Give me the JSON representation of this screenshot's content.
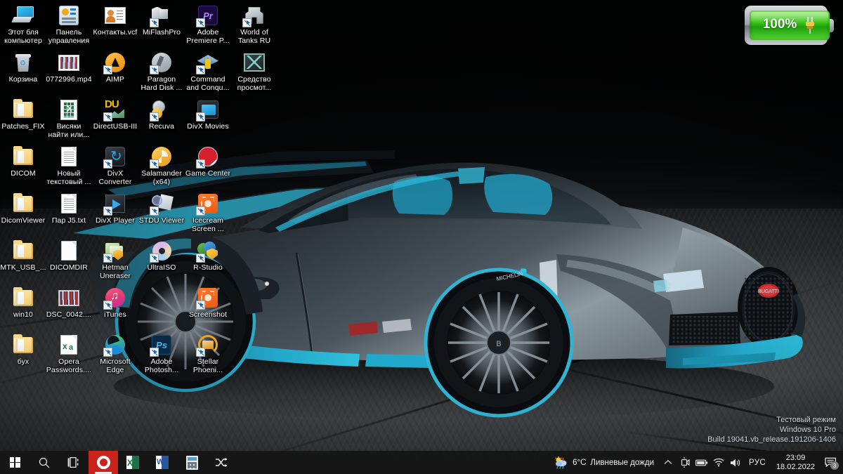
{
  "desktop": {
    "wallpaper_description": "Bugatti Divo supercar, dark grey with cyan accents, on dark asphalt",
    "colors": {
      "car_body_dark": "#2b3238",
      "car_accent_cyan": "#2aa6c8",
      "car_highlight": "#8f9ba3",
      "ground": "#3a3d40",
      "sky": "#07090a",
      "taskbar": "#161616",
      "opera_red": "#c9231c",
      "battery_green": "#35c215"
    },
    "icons": [
      {
        "label_line1": "Этот бля",
        "label_line2": "компьютер",
        "glyph": "this-pc-icon",
        "shortcut": false
      },
      {
        "label_line1": "Панель",
        "label_line2": "управления",
        "glyph": "control-panel-icon",
        "shortcut": false
      },
      {
        "label_line1": "Контакты.vcf",
        "label_line2": "",
        "glyph": "contacts-vcf-icon",
        "shortcut": false
      },
      {
        "label_line1": "MiFlashPro",
        "label_line2": "",
        "glyph": "miflashpro-icon",
        "shortcut": true
      },
      {
        "label_line1": "Adobe",
        "label_line2": "Premiere P...",
        "glyph": "adobe-premiere-icon",
        "shortcut": true
      },
      {
        "label_line1": "World of",
        "label_line2": "Tanks RU",
        "glyph": "world-of-tanks-icon",
        "shortcut": true
      },
      {
        "label_line1": "Корзина",
        "label_line2": "",
        "glyph": "recycle-bin-icon",
        "shortcut": false
      },
      {
        "label_line1": "0772996.mp4",
        "label_line2": "",
        "glyph": "video-thumbnail-icon",
        "shortcut": false
      },
      {
        "label_line1": "AIMP",
        "label_line2": "",
        "glyph": "aimp-icon",
        "shortcut": true
      },
      {
        "label_line1": "Paragon",
        "label_line2": "Hard Disk ...",
        "glyph": "paragon-hard-disk-icon",
        "shortcut": true
      },
      {
        "label_line1": "Command",
        "label_line2": "and Conqu...",
        "glyph": "command-and-conquer-icon",
        "shortcut": true
      },
      {
        "label_line1": "Средство",
        "label_line2": "просмот...",
        "glyph": "snipping-tool-icon",
        "shortcut": false
      },
      {
        "label_line1": "Patches_FIX",
        "label_line2": "",
        "glyph": "folder-icon",
        "shortcut": false
      },
      {
        "label_line1": "Висяки",
        "label_line2": "найти или...",
        "glyph": "excel-file-icon",
        "shortcut": false
      },
      {
        "label_line1": "DirectUSB-III",
        "label_line2": "",
        "glyph": "directusb-icon",
        "shortcut": true
      },
      {
        "label_line1": "Recuva",
        "label_line2": "",
        "glyph": "recuva-icon",
        "shortcut": true
      },
      {
        "label_line1": "DivX Movies",
        "label_line2": "",
        "glyph": "divx-movies-folder-icon",
        "shortcut": true
      },
      {
        "label_line1": "DICOM",
        "label_line2": "",
        "glyph": "folder-icon",
        "shortcut": false
      },
      {
        "label_line1": "Новый",
        "label_line2": "текстовый ...",
        "glyph": "text-document-icon",
        "shortcut": false
      },
      {
        "label_line1": "DivX",
        "label_line2": "Converter",
        "glyph": "divx-converter-icon",
        "shortcut": true
      },
      {
        "label_line1": "Salamander",
        "label_line2": "(x64)",
        "glyph": "salamander-icon",
        "shortcut": true
      },
      {
        "label_line1": "Game Center",
        "label_line2": "",
        "glyph": "game-center-icon",
        "shortcut": true
      },
      {
        "label_line1": "DicomViewer",
        "label_line2": "",
        "glyph": "folder-icon",
        "shortcut": false
      },
      {
        "label_line1": "Пар J5.txt",
        "label_line2": "",
        "glyph": "text-document-icon",
        "shortcut": false
      },
      {
        "label_line1": "DivX Player",
        "label_line2": "",
        "glyph": "divx-player-icon",
        "shortcut": true
      },
      {
        "label_line1": "STDU Viewer",
        "label_line2": "",
        "glyph": "stdu-viewer-icon",
        "shortcut": true
      },
      {
        "label_line1": "Icecream",
        "label_line2": "Screen ...",
        "glyph": "icecream-screen-recorder-icon",
        "shortcut": true
      },
      {
        "label_line1": "MTK_USB_...",
        "label_line2": "",
        "glyph": "folder-icon",
        "shortcut": false
      },
      {
        "label_line1": "DICOMDIR",
        "label_line2": "",
        "glyph": "blank-file-icon",
        "shortcut": false
      },
      {
        "label_line1": "Hetman",
        "label_line2": "Uneraser",
        "glyph": "hetman-uneraser-icon",
        "shortcut": true
      },
      {
        "label_line1": "UltraISO",
        "label_line2": "",
        "glyph": "ultraiso-icon",
        "shortcut": true
      },
      {
        "label_line1": "R-Studio",
        "label_line2": "",
        "glyph": "r-studio-icon",
        "shortcut": true
      },
      {
        "label_line1": "win10",
        "label_line2": "",
        "glyph": "folder-icon",
        "shortcut": false
      },
      {
        "label_line1": "DSC_0042....",
        "label_line2": "",
        "glyph": "photo-thumbnail-icon",
        "shortcut": false
      },
      {
        "label_line1": "iTunes",
        "label_line2": "",
        "glyph": "itunes-icon",
        "shortcut": true
      },
      {
        "label_line1": "Screenshot",
        "label_line2": "",
        "glyph": "screenshot-icon",
        "shortcut": true
      },
      {
        "label_line1": "бух",
        "label_line2": "",
        "glyph": "folder-icon",
        "shortcut": false
      },
      {
        "label_line1": "Opera",
        "label_line2": "Passwords....",
        "glyph": "opera-passwords-excel-icon",
        "shortcut": false
      },
      {
        "label_line1": "Microsoft",
        "label_line2": "Edge",
        "glyph": "microsoft-edge-icon",
        "shortcut": true
      },
      {
        "label_line1": "Adobe",
        "label_line2": "Photosh...",
        "glyph": "adobe-photoshop-icon",
        "shortcut": true
      },
      {
        "label_line1": "Stellar",
        "label_line2": "Phoeni...",
        "glyph": "stellar-phoenix-icon",
        "shortcut": true
      }
    ]
  },
  "battery_gadget": {
    "percent_label": "100%",
    "plug_icon": "power-plug-icon"
  },
  "watermark": {
    "line1": "Тестовый режим",
    "line2": "Windows 10 Pro",
    "line3": "Build 19041.vb_release.191206-1406"
  },
  "taskbar": {
    "buttons": [
      {
        "name": "start-button",
        "icon": "windows-logo-icon",
        "active": false
      },
      {
        "name": "search-button",
        "icon": "search-icon",
        "active": false
      },
      {
        "name": "task-view-button",
        "icon": "task-view-icon",
        "active": false
      },
      {
        "name": "opera-button",
        "icon": "opera-icon",
        "active": true
      },
      {
        "name": "excel-button",
        "icon": "excel-icon",
        "active": false
      },
      {
        "name": "word-button",
        "icon": "word-icon",
        "active": false
      },
      {
        "name": "calculator-button",
        "icon": "calculator-icon",
        "active": false
      },
      {
        "name": "shuffle-button",
        "icon": "shuffle-icon",
        "active": false
      }
    ],
    "weather": {
      "icon": "sun-cloud-rain-icon",
      "temperature": "6°C",
      "condition": "Ливневые дожди"
    },
    "tray": [
      {
        "name": "show-hidden-icons",
        "icon": "chevron-up-icon"
      },
      {
        "name": "camera-tray-icon",
        "icon": "camera-icon"
      },
      {
        "name": "battery-tray-icon",
        "icon": "battery-icon"
      },
      {
        "name": "network-tray-icon",
        "icon": "wifi-icon"
      },
      {
        "name": "volume-tray-icon",
        "icon": "speaker-icon"
      }
    ],
    "language": "РУС",
    "clock": {
      "time": "23:09",
      "date": "18.02.2022"
    },
    "notifications": {
      "icon": "action-center-icon",
      "count": "3"
    }
  }
}
